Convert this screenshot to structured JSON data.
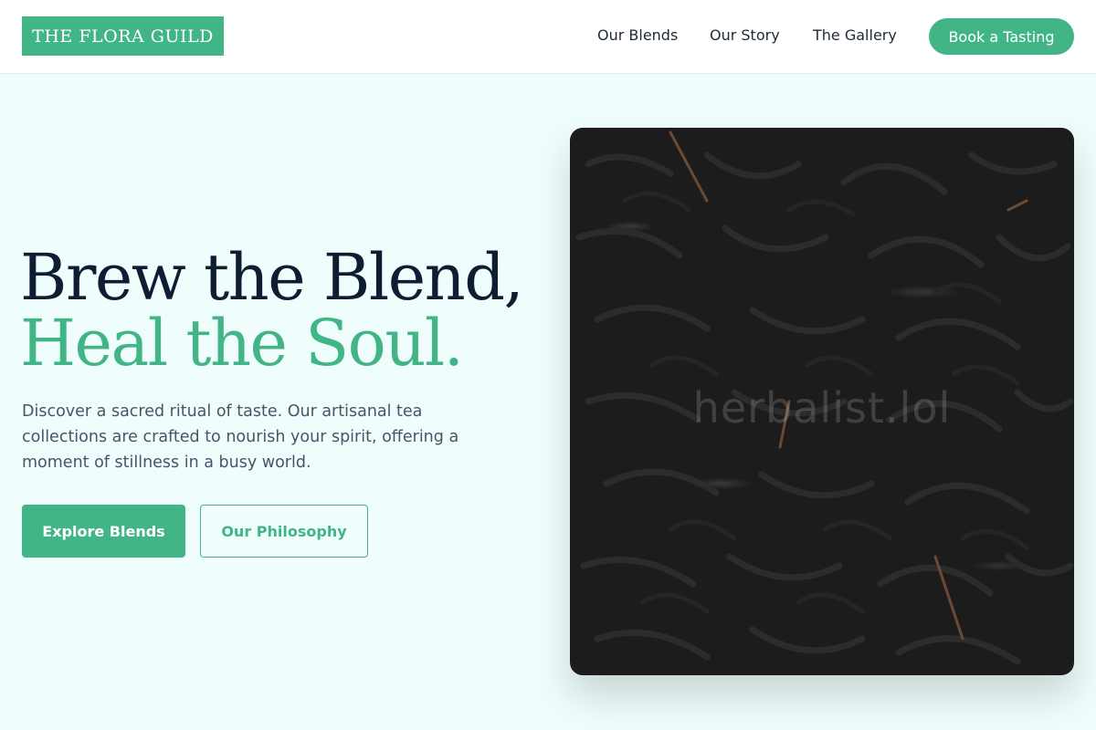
{
  "header": {
    "logo_text": "THE FLORA GUILD",
    "nav": [
      {
        "label": "Our Blends"
      },
      {
        "label": "Our Story"
      },
      {
        "label": "The Gallery"
      }
    ],
    "cta_label": "Book a Tasting"
  },
  "hero": {
    "title_line1": "Brew the Blend,",
    "title_line2": "Heal the Soul.",
    "description": "Discover a sacred ritual of taste. Our artisanal tea collections are crafted to nourish your spirit, offering a moment of stillness in a busy world.",
    "primary_button": "Explore Blends",
    "secondary_button": "Our Philosophy",
    "image_watermark": "herbalist.lol"
  },
  "colors": {
    "accent": "#42b587",
    "heading": "#0f1d33",
    "background": "#effdfc"
  }
}
